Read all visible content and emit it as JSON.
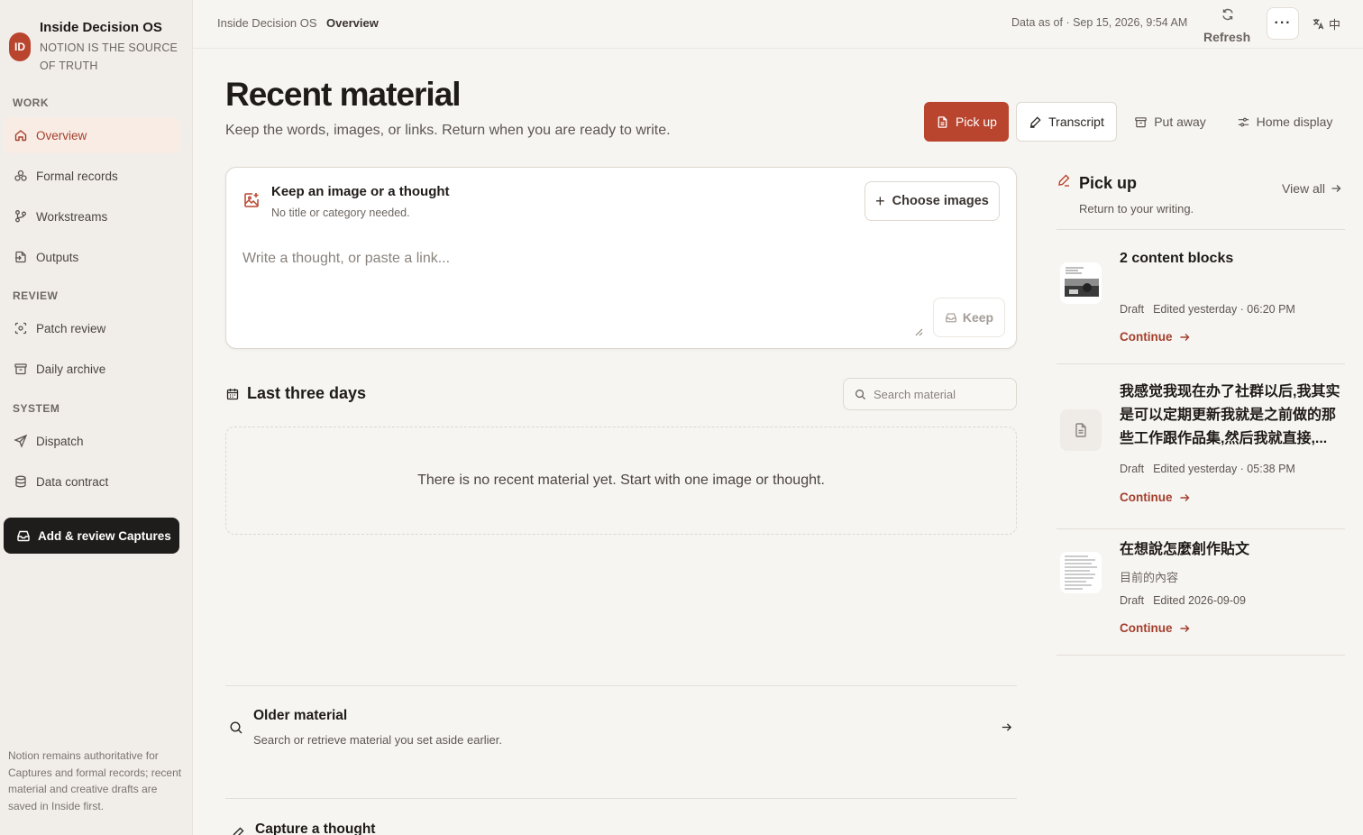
{
  "app": {
    "logo_initials": "ID",
    "name": "Inside Decision OS",
    "tagline": "NOTION IS THE SOURCE OF TRUTH"
  },
  "sidebar": {
    "sections": [
      {
        "label": "WORK"
      },
      {
        "label": "REVIEW"
      },
      {
        "label": "SYSTEM"
      }
    ],
    "items": [
      {
        "label": "Overview",
        "icon": "home-icon",
        "active": true
      },
      {
        "label": "Formal records",
        "icon": "records-icon"
      },
      {
        "label": "Workstreams",
        "icon": "branch-icon"
      },
      {
        "label": "Outputs",
        "icon": "output-icon"
      },
      {
        "label": "Patch review",
        "icon": "scan-icon"
      },
      {
        "label": "Daily archive",
        "icon": "archive-icon"
      },
      {
        "label": "Dispatch",
        "icon": "send-icon"
      },
      {
        "label": "Data contract",
        "icon": "database-icon"
      }
    ],
    "cta_label": "Add & review Captures",
    "note": "Notion remains authoritative for Captures and formal records; recent material and creative drafts are saved in Inside first."
  },
  "topbar": {
    "breadcrumb_root": "Inside Decision OS",
    "breadcrumb_current": "Overview",
    "data_as_of": "Data as of · Sep 15, 2026, 9:54 AM",
    "refresh_label": "Refresh",
    "more_label": "···",
    "lang_label": "中"
  },
  "page": {
    "title": "Recent material",
    "subtitle": "Keep the words, images, or links. Return when you are ready to write.",
    "actions": {
      "pick_up": "Pick up",
      "transcript": "Transcript",
      "put_away": "Put away",
      "home_display": "Home display"
    }
  },
  "keep_card": {
    "title": "Keep an image or a thought",
    "subtitle": "No title or category needed.",
    "choose_images": "Choose images",
    "placeholder": "Write a thought, or paste a link...",
    "keep_label": "Keep"
  },
  "recent": {
    "title": "Last three days",
    "search_placeholder": "Search material",
    "empty_text": "There is no recent material yet. Start with one image or thought."
  },
  "older": {
    "title": "Older material",
    "subtitle": "Search or retrieve material you set aside earlier."
  },
  "capture": {
    "title": "Capture a thought"
  },
  "pickup_panel": {
    "title": "Pick up",
    "subtitle": "Return to your writing.",
    "view_all": "View all",
    "continue_label": "Continue",
    "drafts": [
      {
        "title": "2 content blocks",
        "status": "Draft",
        "edited": "Edited yesterday · 06:20 PM",
        "thumb": "photo"
      },
      {
        "title": "我感觉我现在办了社群以后,我其实是可以定期更新我就是之前做的那些工作跟作品集,然后我就直接,...",
        "status": "Draft",
        "edited": "Edited yesterday · 05:38 PM",
        "thumb": "document-icon"
      },
      {
        "title": "在想說怎麼創作貼文",
        "subtitle": "目前的內容",
        "status": "Draft",
        "edited": "Edited 2026-09-09",
        "thumb": "text-page"
      }
    ]
  },
  "colors": {
    "accent": "#b9452f",
    "background": "#f7f5f2",
    "sidebar": "#f1eeea",
    "dark": "#1f1d1b"
  }
}
